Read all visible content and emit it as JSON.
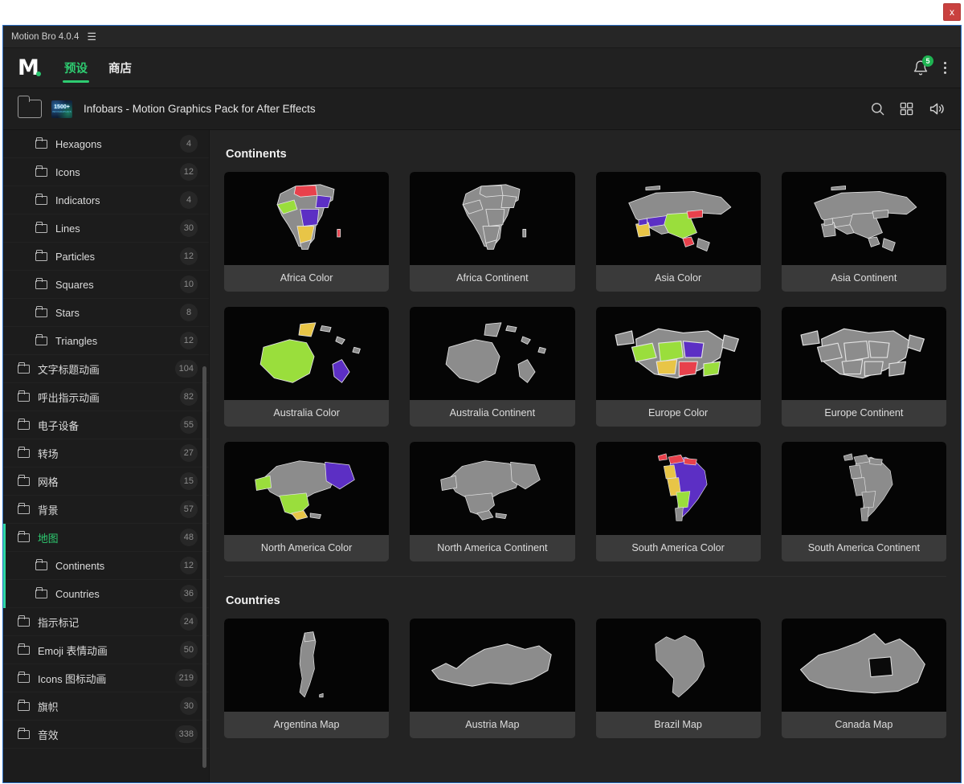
{
  "window": {
    "close_label": "x"
  },
  "plugin_titlebar": {
    "title": "Motion Bro 4.0.4",
    "menu_icon": "hamburger-icon"
  },
  "header": {
    "logo": "motion-bro-logo",
    "tabs": [
      {
        "label": "预设",
        "active": true
      },
      {
        "label": "商店",
        "active": false
      }
    ],
    "notification_count": "5",
    "bell_icon": "bell-icon",
    "more_icon": "kebab-menu-icon"
  },
  "breadcrumb": {
    "folder_icon": "folder-icon",
    "thumb_line1": "1500+",
    "thumb_line2": "INFOGRAPHICS",
    "title": "Infobars - Motion Graphics Pack for After Effects",
    "actions": [
      "search-icon",
      "grid-view-icon",
      "sound-icon"
    ]
  },
  "sidebar": {
    "items": [
      {
        "label": "Hexagons",
        "count": "4",
        "level": 1,
        "selected": false,
        "group": false
      },
      {
        "label": "Icons",
        "count": "12",
        "level": 1,
        "selected": false,
        "group": false
      },
      {
        "label": "Indicators",
        "count": "4",
        "level": 1,
        "selected": false,
        "group": false
      },
      {
        "label": "Lines",
        "count": "30",
        "level": 1,
        "selected": false,
        "group": false
      },
      {
        "label": "Particles",
        "count": "12",
        "level": 1,
        "selected": false,
        "group": false
      },
      {
        "label": "Squares",
        "count": "10",
        "level": 1,
        "selected": false,
        "group": false
      },
      {
        "label": "Stars",
        "count": "8",
        "level": 1,
        "selected": false,
        "group": false
      },
      {
        "label": "Triangles",
        "count": "12",
        "level": 1,
        "selected": false,
        "group": false
      },
      {
        "label": "文字标题动画",
        "count": "104",
        "level": 0,
        "selected": false,
        "group": false
      },
      {
        "label": "呼出指示动画",
        "count": "82",
        "level": 0,
        "selected": false,
        "group": false
      },
      {
        "label": "电子设备",
        "count": "55",
        "level": 0,
        "selected": false,
        "group": false
      },
      {
        "label": "转场",
        "count": "27",
        "level": 0,
        "selected": false,
        "group": false
      },
      {
        "label": "网格",
        "count": "15",
        "level": 0,
        "selected": false,
        "group": false
      },
      {
        "label": "背景",
        "count": "57",
        "level": 0,
        "selected": false,
        "group": false
      },
      {
        "label": "地图",
        "count": "48",
        "level": 0,
        "selected": true,
        "group": true
      },
      {
        "label": "Continents",
        "count": "12",
        "level": 1,
        "selected": false,
        "group": true
      },
      {
        "label": "Countries",
        "count": "36",
        "level": 1,
        "selected": false,
        "group": true
      },
      {
        "label": "指示标记",
        "count": "24",
        "level": 0,
        "selected": false,
        "group": false
      },
      {
        "label": "Emoji 表情动画",
        "count": "50",
        "level": 0,
        "selected": false,
        "group": false
      },
      {
        "label": "Icons 图标动画",
        "count": "219",
        "level": 0,
        "selected": false,
        "group": false
      },
      {
        "label": "旗帜",
        "count": "30",
        "level": 0,
        "selected": false,
        "group": false
      },
      {
        "label": "音效",
        "count": "338",
        "level": 0,
        "selected": false,
        "group": false
      }
    ]
  },
  "main": {
    "sections": [
      {
        "title": "Continents",
        "cards": [
          {
            "label": "Africa Color",
            "map": "africa",
            "colored": true
          },
          {
            "label": "Africa Continent",
            "map": "africa",
            "colored": false
          },
          {
            "label": "Asia Color",
            "map": "asia",
            "colored": true
          },
          {
            "label": "Asia Continent",
            "map": "asia",
            "colored": false
          },
          {
            "label": "Australia Color",
            "map": "oceania",
            "colored": true
          },
          {
            "label": "Australia Continent",
            "map": "oceania",
            "colored": false
          },
          {
            "label": "Europe Color",
            "map": "europe",
            "colored": true
          },
          {
            "label": "Europe Continent",
            "map": "europe",
            "colored": false
          },
          {
            "label": "North America Color",
            "map": "namerica",
            "colored": true
          },
          {
            "label": "North America Continent",
            "map": "namerica",
            "colored": false
          },
          {
            "label": "South America Color",
            "map": "samerica",
            "colored": true
          },
          {
            "label": "South America Continent",
            "map": "samerica",
            "colored": false
          }
        ]
      },
      {
        "title": "Countries",
        "cards": [
          {
            "label": "Argentina Map",
            "map": "argentina",
            "colored": false
          },
          {
            "label": "Austria Map",
            "map": "austria",
            "colored": false
          },
          {
            "label": "Brazil Map",
            "map": "brazil",
            "colored": false
          },
          {
            "label": "Canada Map",
            "map": "canada",
            "colored": false
          }
        ]
      }
    ]
  },
  "colors": {
    "accent_green": "#2ecc71",
    "map_gray": "#8c8c8c",
    "map_lime": "#9ade3c",
    "map_purple": "#5c2fc4",
    "map_red": "#e8414c",
    "map_yellow": "#e8c547",
    "badge_green": "#1fb352",
    "panel_bg": "#232323",
    "sidebar_bg": "#1c1c1c",
    "card_bg": "#3a3a3a",
    "thumb_bg": "#050505"
  }
}
